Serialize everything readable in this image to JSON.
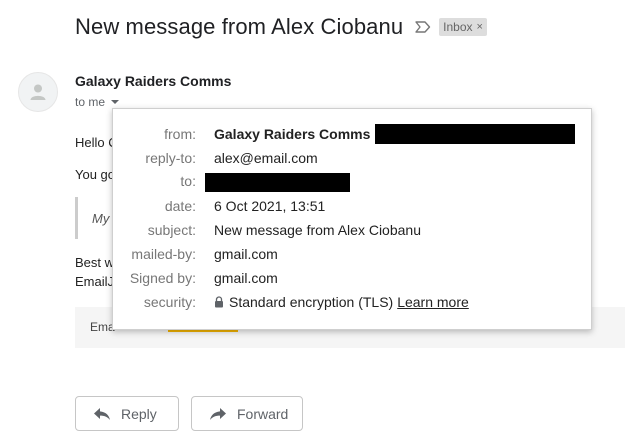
{
  "header": {
    "subject": "New message from Alex Ciobanu",
    "important_icon": "label-important-outline-icon",
    "label_chip": "Inbox",
    "label_chip_close": "×"
  },
  "sender": {
    "avatar_icon": "person-icon",
    "name": "Galaxy Raiders Comms",
    "recipient_summary": "to me",
    "details_toggle_icon": "caret-down-icon"
  },
  "body": {
    "greeting_partial": "Hello C",
    "line2_partial": "You go",
    "quote_partial": "My",
    "signoff_partial": "Best w",
    "signoff2_partial": "EmailJ",
    "footer_partial": "Ema"
  },
  "details": {
    "rows": [
      {
        "label": "from:",
        "value": "Galaxy Raiders Comms",
        "redacted": true
      },
      {
        "label": "reply-to:",
        "value": "alex@email.com"
      },
      {
        "label": "to:",
        "value": "",
        "redacted": true
      },
      {
        "label": "date:",
        "value": "6 Oct 2021, 13:51"
      },
      {
        "label": "subject:",
        "value": "New message from Alex Ciobanu"
      },
      {
        "label": "mailed-by:",
        "value": "gmail.com"
      },
      {
        "label": "Signed by:",
        "value": "gmail.com"
      },
      {
        "label": "security:",
        "value": "Standard encryption (TLS)",
        "link": "Learn more",
        "icon": "lock-icon"
      }
    ]
  },
  "actions": {
    "reply_label": "Reply",
    "reply_icon": "reply-icon",
    "forward_label": "Forward",
    "forward_icon": "forward-icon"
  },
  "colors": {
    "chip_background": "#dddddd",
    "redaction": "#000000",
    "footer_accent": "#f4b400"
  }
}
